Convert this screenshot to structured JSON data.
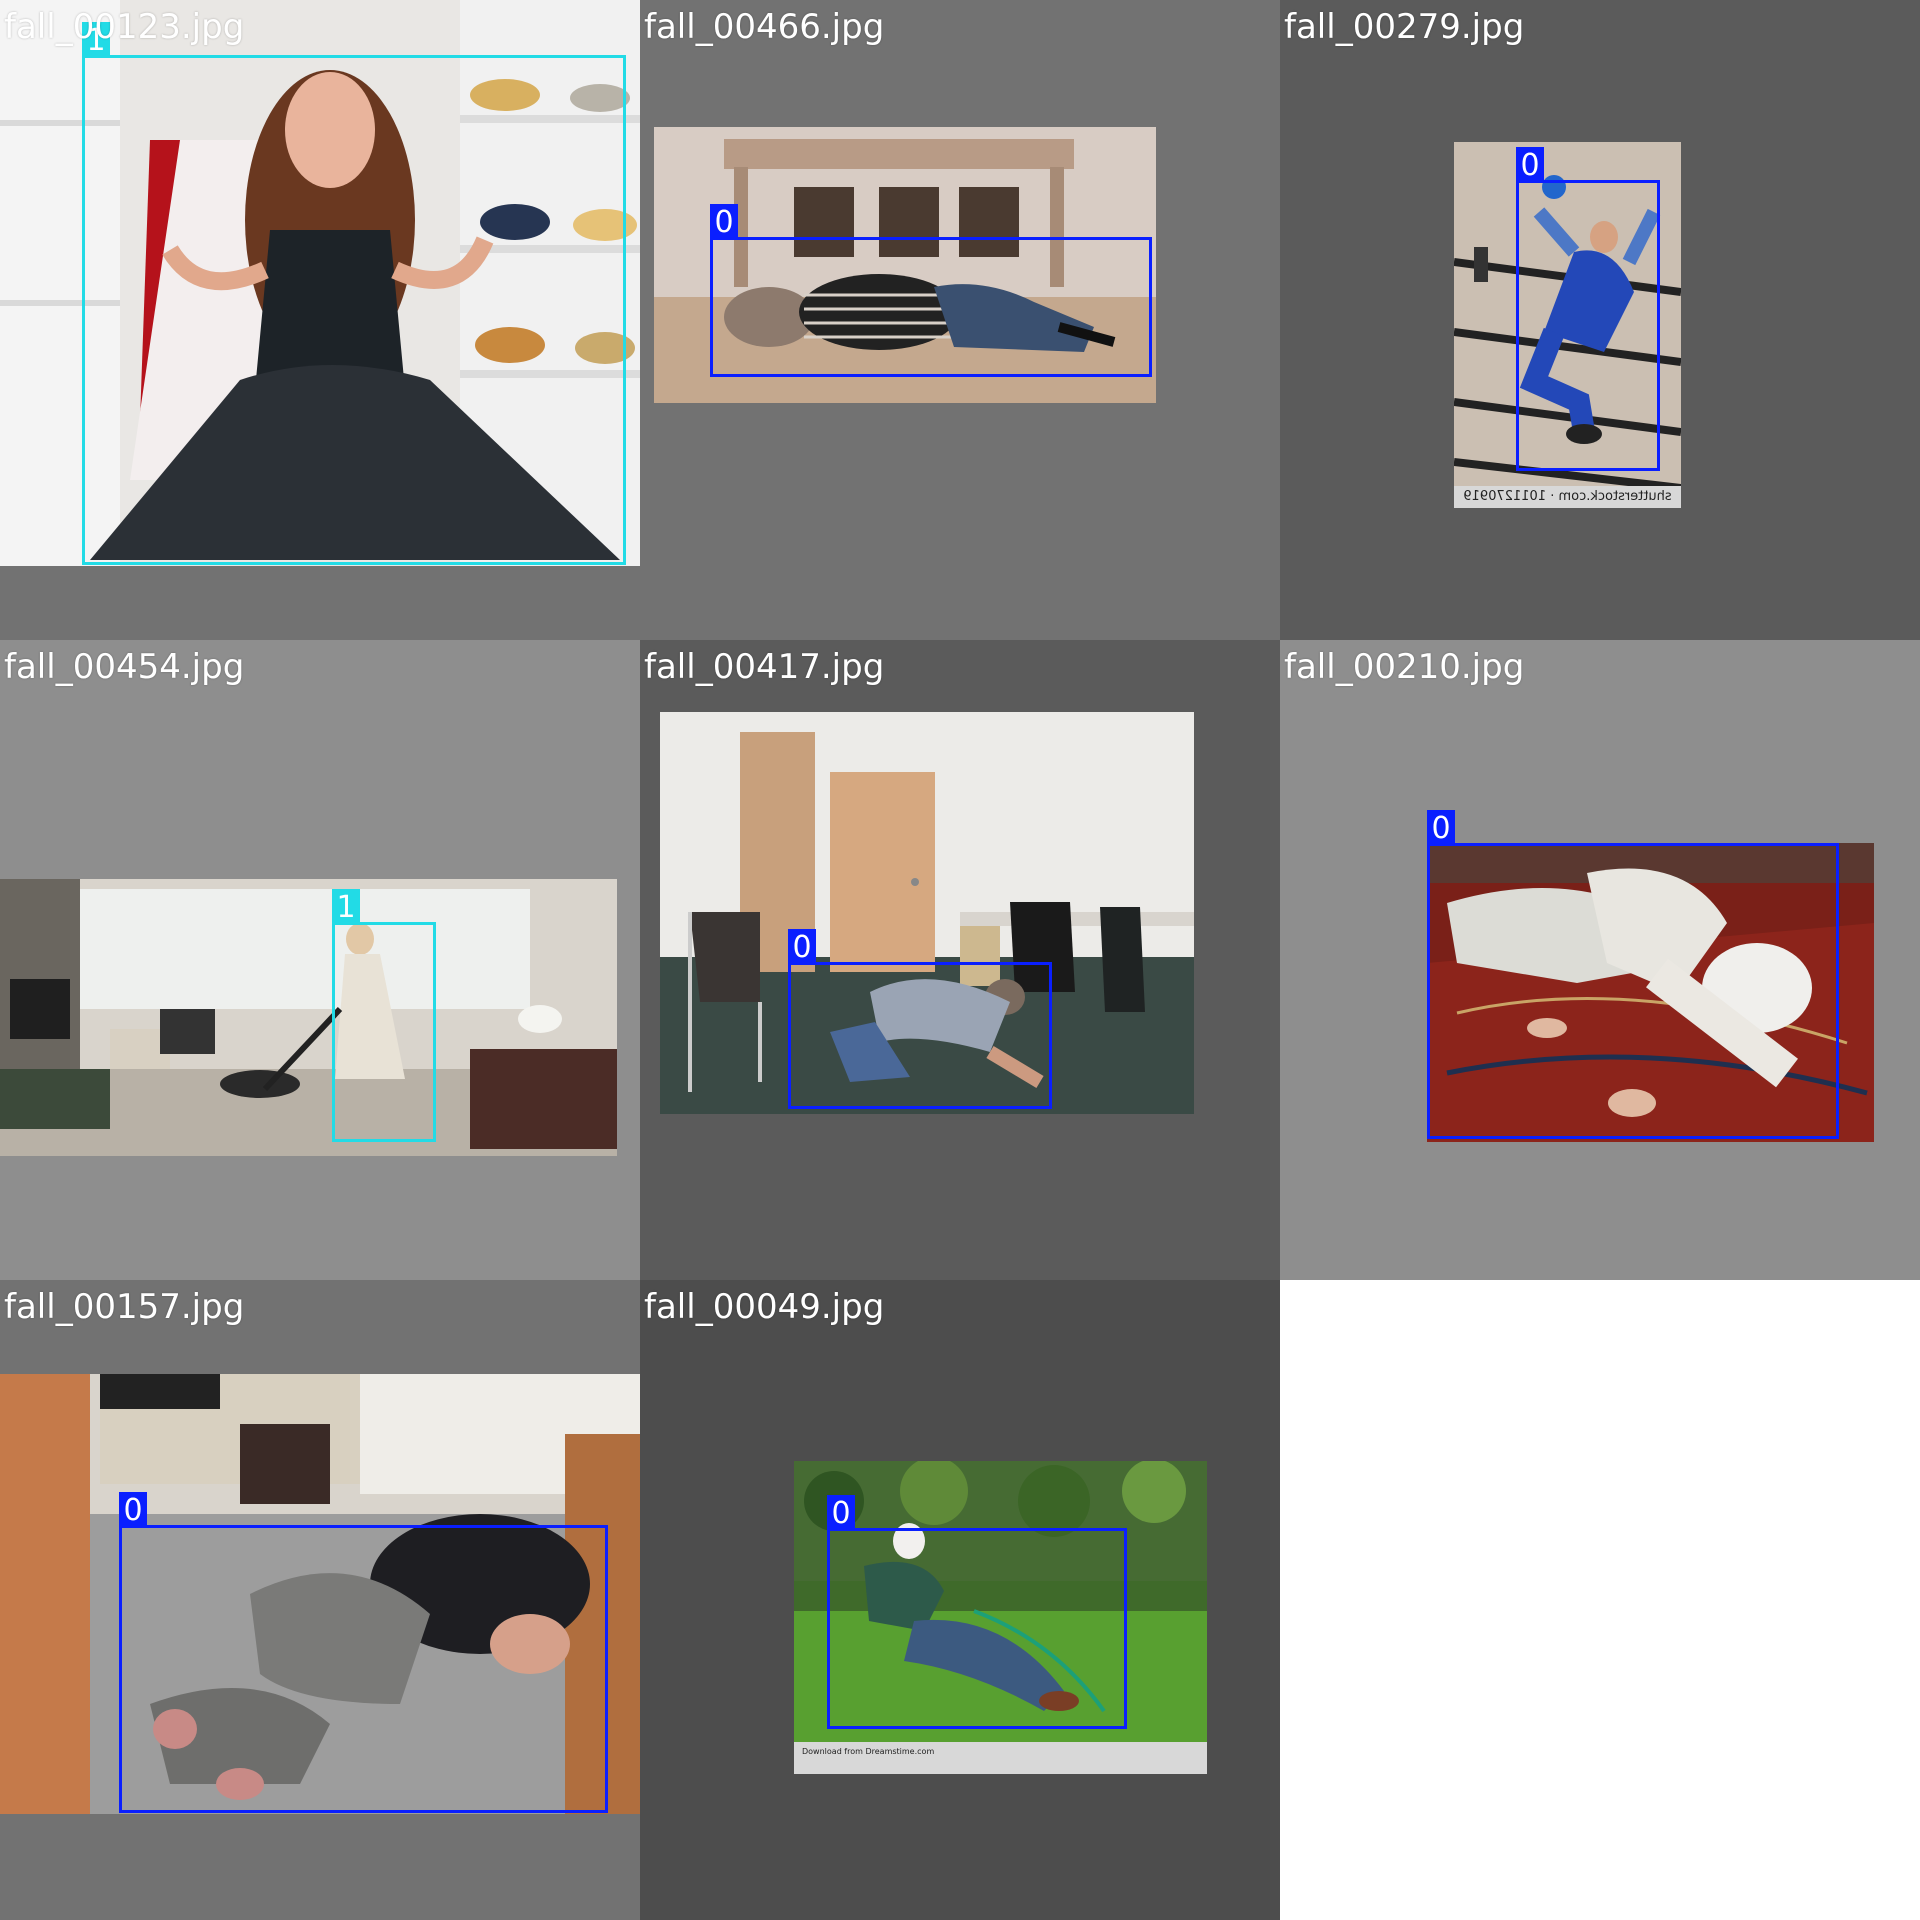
{
  "mosaic": {
    "tiles": [
      {
        "filename": "fall_00123.jpg",
        "scene": "closet",
        "boxes": [
          {
            "label": "1",
            "class_color": "#22dbe6"
          }
        ]
      },
      {
        "filename": "fall_00466.jpg",
        "scene": "dining-floor",
        "boxes": [
          {
            "label": "0",
            "class_color": "#0a1fff"
          }
        ]
      },
      {
        "filename": "fall_00279.jpg",
        "scene": "stairs",
        "watermark": "shutterstock.com · 1011270919",
        "boxes": [
          {
            "label": "0",
            "class_color": "#0a1fff"
          }
        ]
      },
      {
        "filename": "fall_00454.jpg",
        "scene": "living-room",
        "boxes": [
          {
            "label": "1",
            "class_color": "#22dbe6"
          }
        ]
      },
      {
        "filename": "fall_00417.jpg",
        "scene": "office",
        "boxes": [
          {
            "label": "0",
            "class_color": "#0a1fff"
          }
        ]
      },
      {
        "filename": "fall_00210.jpg",
        "scene": "rug",
        "boxes": [
          {
            "label": "0",
            "class_color": "#0a1fff"
          }
        ]
      },
      {
        "filename": "fall_00157.jpg",
        "scene": "kitchen-floor",
        "boxes": [
          {
            "label": "0",
            "class_color": "#0a1fff"
          }
        ]
      },
      {
        "filename": "fall_00049.jpg",
        "scene": "garden",
        "watermark": "Download from Dreamstime.com",
        "boxes": [
          {
            "label": "0",
            "class_color": "#0a1fff"
          }
        ]
      }
    ]
  }
}
